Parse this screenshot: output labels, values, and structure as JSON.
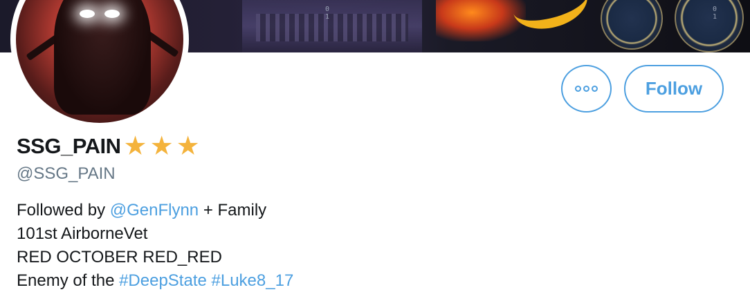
{
  "profile": {
    "display_name": "SSG_PAIN",
    "name_badge": "★★★",
    "handle": "@SSG_PAIN",
    "banner_digits": [
      "0\n1",
      "0\n1"
    ]
  },
  "actions": {
    "more_icon": "more-horizontal-icon",
    "follow_label": "Follow"
  },
  "bio": {
    "line1_prefix": "Followed by ",
    "line1_mention": "@GenFlynn",
    "line1_suffix": " + Family",
    "line2": "101st AirborneVet",
    "line3": "RED OCTOBER RED_RED",
    "line4_prefix": "Enemy of the ",
    "line4_hashtag1": "#DeepState",
    "line4_space": " ",
    "line4_hashtag2": "#Luke8_17"
  },
  "colors": {
    "accent": "#4c9fe0",
    "text": "#14171a",
    "muted": "#657786",
    "star": "#f4b33c"
  }
}
